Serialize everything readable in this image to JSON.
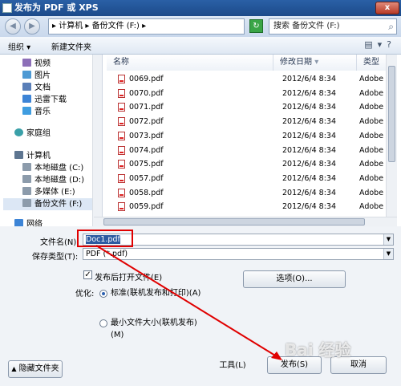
{
  "window": {
    "title": "发布为 PDF 或 XPS",
    "close": "x"
  },
  "address": {
    "path": "▸ 计算机 ▸ 备份文件 (F:) ▸",
    "search_placeholder": "搜索 备份文件 (F:)"
  },
  "toolbar": {
    "organize": "组织 ▾",
    "new_folder": "新建文件夹"
  },
  "nav": {
    "items": [
      {
        "label": "视频",
        "color": "#8d6fb8"
      },
      {
        "label": "图片",
        "color": "#4e9ad4"
      },
      {
        "label": "文档",
        "color": "#5a7fb8"
      },
      {
        "label": "迅雷下载",
        "color": "#3d84d6"
      },
      {
        "label": "音乐",
        "color": "#3f9de0"
      },
      {
        "label": "家庭组",
        "color": "#3aa0a8"
      },
      {
        "label": "计算机",
        "color": "#5d7590"
      },
      {
        "label": "本地磁盘 (C:)",
        "color": "#8c9bab"
      },
      {
        "label": "本地磁盘 (D:)",
        "color": "#8c9bab"
      },
      {
        "label": "多媒体 (E:)",
        "color": "#8c9bab"
      },
      {
        "label": "备份文件 (F:)",
        "color": "#8c9bab"
      },
      {
        "label": "网络",
        "color": "#3d84d6"
      }
    ]
  },
  "columns": {
    "name": "名称",
    "modified": "修改日期",
    "type": "类型"
  },
  "files": [
    {
      "name": "0069.pdf",
      "date": "2012/6/4 8:34",
      "type": "Adobe A"
    },
    {
      "name": "0070.pdf",
      "date": "2012/6/4 8:34",
      "type": "Adobe A"
    },
    {
      "name": "0071.pdf",
      "date": "2012/6/4 8:34",
      "type": "Adobe A"
    },
    {
      "name": "0072.pdf",
      "date": "2012/6/4 8:34",
      "type": "Adobe A"
    },
    {
      "name": "0073.pdf",
      "date": "2012/6/4 8:34",
      "type": "Adobe A"
    },
    {
      "name": "0074.pdf",
      "date": "2012/6/4 8:34",
      "type": "Adobe A"
    },
    {
      "name": "0075.pdf",
      "date": "2012/6/4 8:34",
      "type": "Adobe A"
    },
    {
      "name": "0057.pdf",
      "date": "2012/6/4 8:34",
      "type": "Adobe A"
    },
    {
      "name": "0058.pdf",
      "date": "2012/6/4 8:34",
      "type": "Adobe A"
    },
    {
      "name": "0059.pdf",
      "date": "2012/6/4 8:34",
      "type": "Adobe A"
    }
  ],
  "form": {
    "filename_label": "文件名(N):",
    "filename_value": "Doc1.pdf",
    "filetype_label": "保存类型(T):",
    "filetype_value": "PDF (*.pdf)",
    "open_after_label": "发布后打开文件(E)",
    "open_after_checked": true,
    "optimize_label": "优化:",
    "option_standard": "标准(联机发布和打印)(A)",
    "option_minimum": "最小文件大小(联机发布)(M)",
    "options_button": "选项(O)...",
    "hide_folders": "隐藏文件夹",
    "tools": "工具(L)",
    "publish": "发布(S)",
    "cancel": "取消"
  },
  "annotation": {
    "color": "#e00000"
  },
  "watermark": "Bai 经验"
}
